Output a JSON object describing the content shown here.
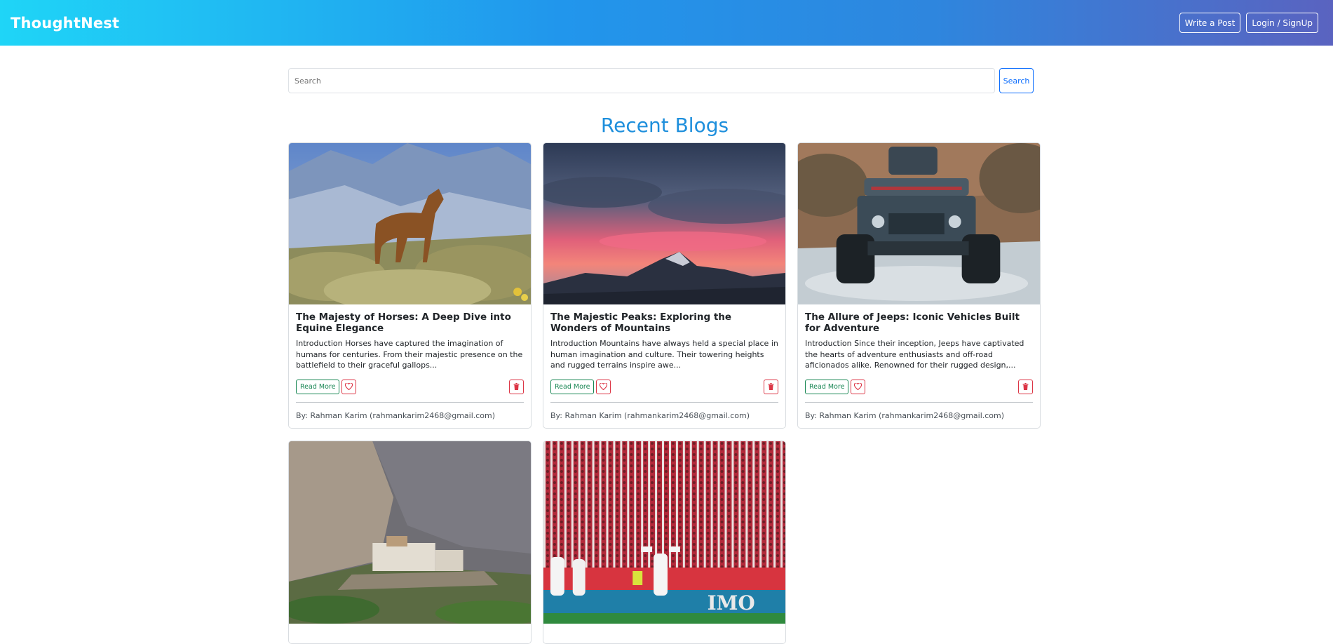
{
  "navbar": {
    "brand": "ThoughtNest",
    "write_post": "Write a Post",
    "login_signup": "Login / SignUp"
  },
  "search": {
    "placeholder": "Search",
    "button": "Search"
  },
  "section_title": "Recent Blogs",
  "cards": [
    {
      "title": "The Majesty of Horses: A Deep Dive into Equine Elegance",
      "excerpt": "Introduction Horses have captured the imagination of humans for centuries. From their majestic presence on the battlefield to their graceful gallops...",
      "read_more": "Read More",
      "author": "By: Rahman Karim (rahmankarim2468@gmail.com)",
      "image": "horse-photo"
    },
    {
      "title": "The Majestic Peaks: Exploring the Wonders of Mountains",
      "excerpt": "Introduction Mountains have always held a special place in human imagination and culture. Their towering heights and rugged terrains inspire awe...",
      "read_more": "Read More",
      "author": "By: Rahman Karim (rahmankarim2468@gmail.com)",
      "image": "mountain-sunset-photo"
    },
    {
      "title": "The Allure of Jeeps: Iconic Vehicles Built for Adventure",
      "excerpt": "Introduction Since their inception, Jeeps have captivated the hearts of adventure enthusiasts and off-road aficionados alike. Renowned for their rugged design,...",
      "read_more": "Read More",
      "author": "By: Rahman Karim (rahmankarim2468@gmail.com)",
      "image": "jeep-photo"
    },
    {
      "image": "fort-photo"
    },
    {
      "image": "stadium-photo",
      "image_text": "IMO"
    }
  ],
  "icons": {
    "like": "heart-icon",
    "delete": "trash-icon"
  },
  "colors": {
    "brand_gradient_start": "#1fd5f7",
    "brand_gradient_end": "#5a63c0",
    "title": "#1e8fdc",
    "read_more": "#198754",
    "danger": "#dc3545",
    "search_button": "#0d6efd"
  }
}
